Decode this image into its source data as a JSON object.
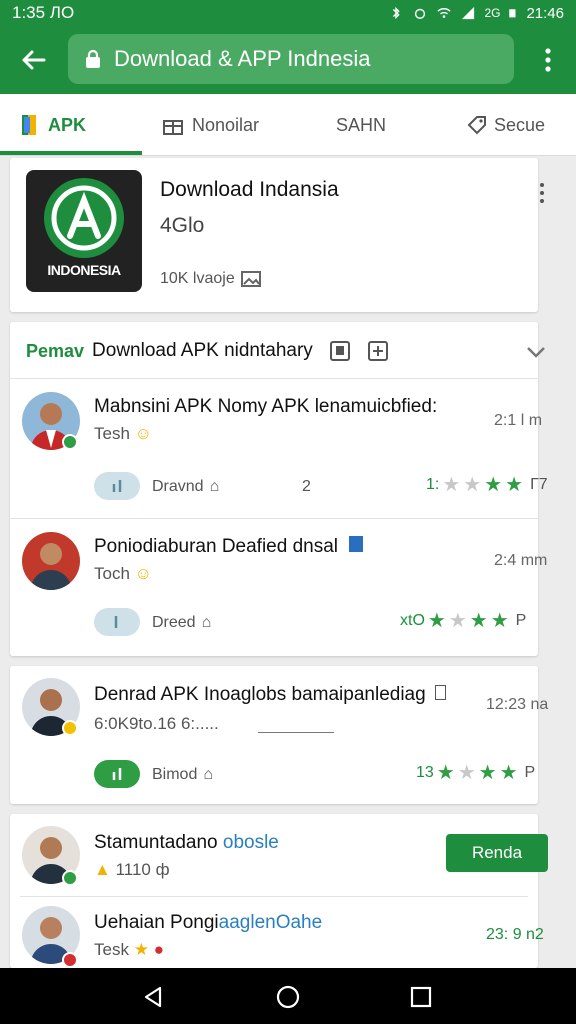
{
  "status": {
    "time": "1:35 ЛО",
    "right_text": "2G",
    "clock": "21:46"
  },
  "appbar": {
    "url_title": "Download & APP Indnesia"
  },
  "tabs": [
    {
      "label": "APK"
    },
    {
      "label": "Nonoilar"
    },
    {
      "label": "SAHN"
    },
    {
      "label": "Secue"
    }
  ],
  "featured": {
    "icon_text": "INDONESIA",
    "name": "Download Indansia",
    "size": "4Glo",
    "downloads": "10K lvaoje"
  },
  "section": {
    "tag": "Pemav",
    "title": "Download APK nidntahary"
  },
  "items": [
    {
      "title": "Mabnsini APK Nomy APK lenamuicbfied:",
      "sub": "Tesh",
      "time": "2:1 l m",
      "meta": "Dravnd",
      "count": "2",
      "rating_text": "1:",
      "suffix": "Г7"
    },
    {
      "title": "Poniodiaburan Deafied dnsal",
      "sub": "Toch",
      "time": "2:4 mm",
      "meta": "Dreed",
      "rating_text": "xtO",
      "suffix": "Р"
    },
    {
      "title": "Denrad APK Inoaglobs bamaipanlediag",
      "sub": "6:0K9to.16 6:.....",
      "time": "12:23 na",
      "meta": "Bimod",
      "rating_text": "13",
      "suffix": "Р"
    },
    {
      "title": "Stamuntadano",
      "title_accent": "obosle",
      "sub": "1110 ф",
      "button": "Renda"
    },
    {
      "title": "Uehaian Pongi",
      "title_accent": "aaglenOahe",
      "sub": "Tesk",
      "time": "23: 9 n2"
    }
  ],
  "colors": {
    "primary": "#1e8e3e",
    "accent_text": "#2a7fbf"
  }
}
